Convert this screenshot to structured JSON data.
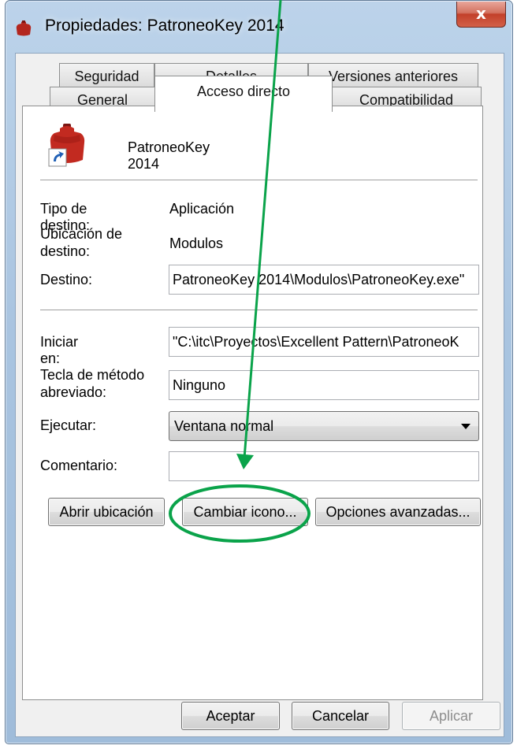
{
  "window": {
    "title": "Propiedades: PatroneoKey 2014",
    "close_label": "x"
  },
  "tabs": {
    "row1": [
      "Seguridad",
      "Detalles",
      "Versiones anteriores"
    ],
    "row2": [
      "General",
      "Acceso directo",
      "Compatibilidad"
    ],
    "active": "Acceso directo"
  },
  "shortcut": {
    "name": "PatroneoKey 2014",
    "target_type_label": "Tipo de destino:",
    "target_type_value": "Aplicación",
    "target_location_label": "Ubicación de destino:",
    "target_location_value": "Modulos",
    "target_label": "Destino:",
    "target_value": "PatroneoKey 2014\\Modulos\\PatroneoKey.exe\"",
    "start_in_label": "Iniciar en:",
    "start_in_value": "\"C:\\itc\\Proyectos\\Excellent Pattern\\PatroneoK",
    "hotkey_label": "Tecla de método abreviado:",
    "hotkey_value": "Ninguno",
    "run_label": "Ejecutar:",
    "run_value": "Ventana normal",
    "comment_label": "Comentario:",
    "comment_value": ""
  },
  "buttons": {
    "open_location": "Abrir ubicación",
    "change_icon": "Cambiar icono...",
    "advanced": "Opciones avanzadas...",
    "ok": "Aceptar",
    "cancel": "Cancelar",
    "apply": "Aplicar"
  },
  "annotation": {
    "color": "#0aa34a"
  },
  "icons": {
    "app": "red-mannequin-icon",
    "shortcut_overlay": "shortcut-arrow-icon"
  }
}
